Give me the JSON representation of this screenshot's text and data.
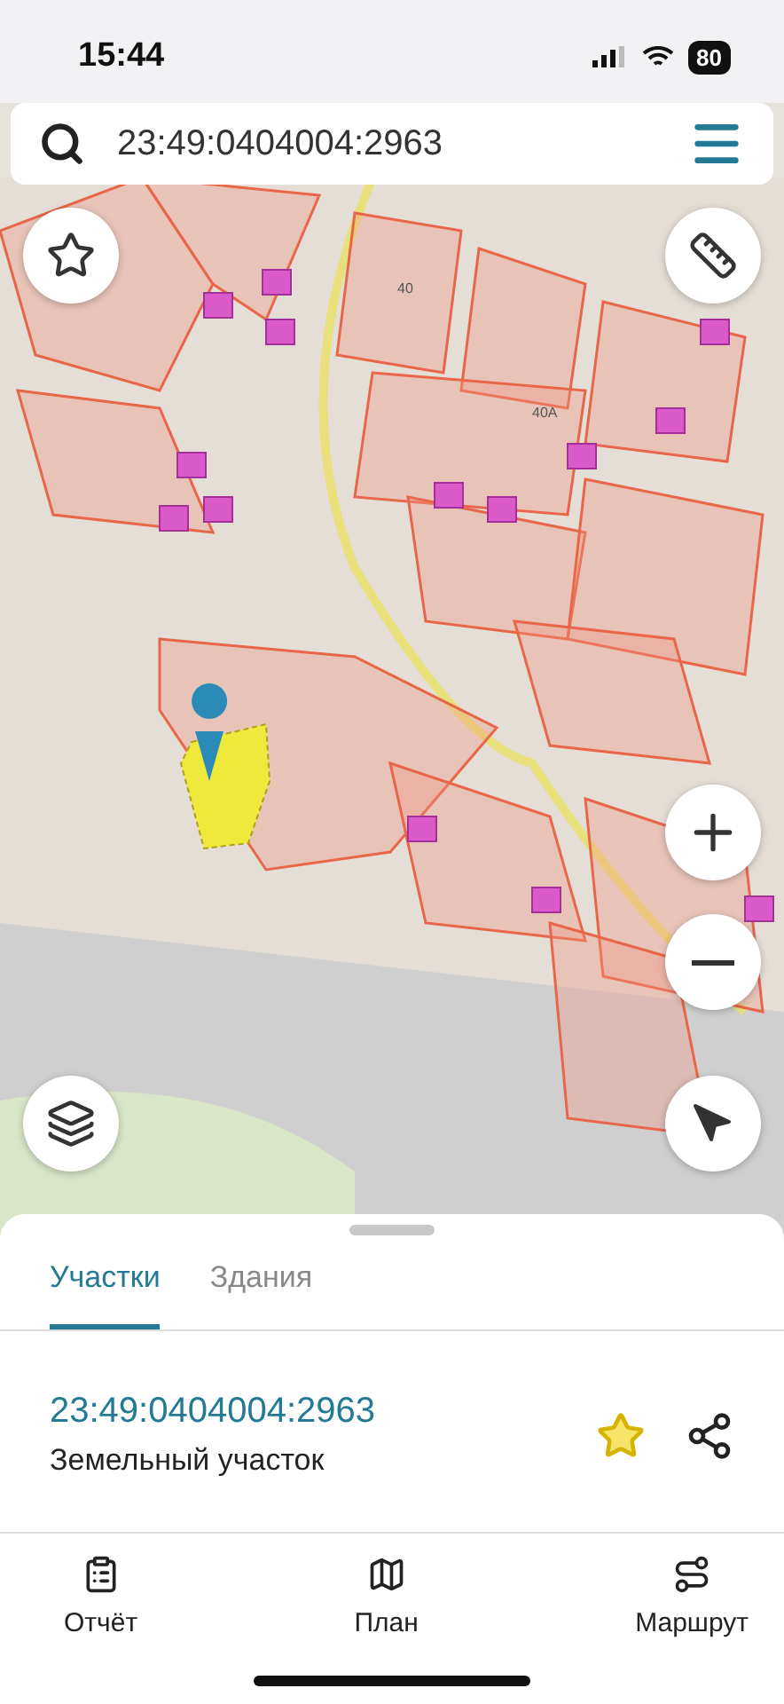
{
  "status_bar": {
    "time": "15:44",
    "battery": "80"
  },
  "search": {
    "value": "23:49:0404004:2963"
  },
  "map": {
    "labels": [
      {
        "text": "40"
      },
      {
        "text": "40А"
      }
    ]
  },
  "sheet": {
    "tabs": [
      {
        "label": "Участки",
        "selected": true
      },
      {
        "label": "Здания",
        "selected": false
      }
    ],
    "result": {
      "number": "23:49:0404004:2963",
      "type": "Земельный участок",
      "favorite": true
    }
  },
  "bottom_nav": [
    {
      "kind": "report",
      "label": "Отчёт"
    },
    {
      "kind": "plan",
      "label": "План"
    },
    {
      "kind": "route",
      "label": "Маршрут"
    }
  ]
}
